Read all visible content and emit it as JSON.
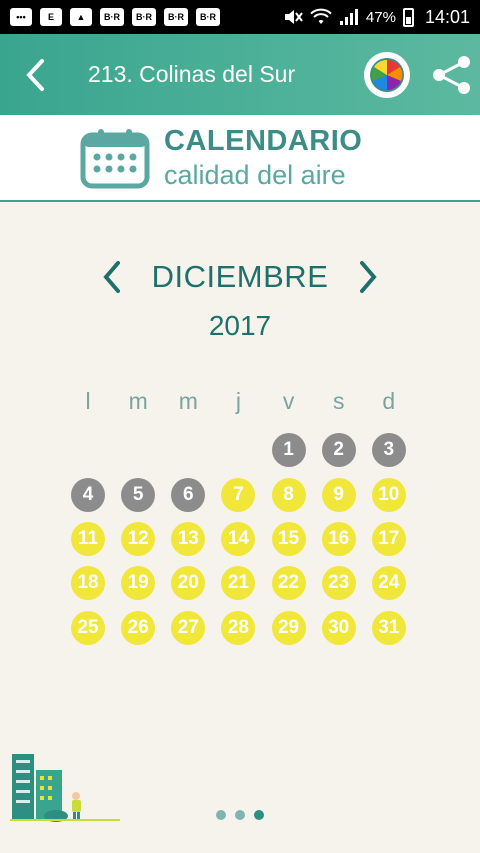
{
  "status_bar": {
    "battery": "47%",
    "time": "14:01",
    "icons": [
      "messenger-icon",
      "app-e-icon",
      "gallery-icon",
      "br-icon",
      "br-icon",
      "br-icon",
      "br-icon"
    ],
    "br_label": "B·R"
  },
  "app_bar": {
    "title": "213. Colinas del Sur",
    "background": "#3aa58f"
  },
  "header": {
    "title": "CALENDARIO",
    "subtitle": "calidad del aire"
  },
  "calendar": {
    "month": "DICIEMBRE",
    "year": "2017",
    "weekdays": [
      "l",
      "m",
      "m",
      "j",
      "v",
      "s",
      "d"
    ],
    "days": [
      {
        "n": "",
        "q": "empty"
      },
      {
        "n": "",
        "q": "empty"
      },
      {
        "n": "",
        "q": "empty"
      },
      {
        "n": "",
        "q": "empty"
      },
      {
        "n": "1",
        "q": "grey"
      },
      {
        "n": "2",
        "q": "grey"
      },
      {
        "n": "3",
        "q": "grey"
      },
      {
        "n": "4",
        "q": "grey"
      },
      {
        "n": "5",
        "q": "grey"
      },
      {
        "n": "6",
        "q": "grey"
      },
      {
        "n": "7",
        "q": "yellow"
      },
      {
        "n": "8",
        "q": "yellow"
      },
      {
        "n": "9",
        "q": "yellow"
      },
      {
        "n": "10",
        "q": "yellow"
      },
      {
        "n": "11",
        "q": "yellow"
      },
      {
        "n": "12",
        "q": "yellow"
      },
      {
        "n": "13",
        "q": "yellow"
      },
      {
        "n": "14",
        "q": "yellow"
      },
      {
        "n": "15",
        "q": "yellow"
      },
      {
        "n": "16",
        "q": "yellow"
      },
      {
        "n": "17",
        "q": "yellow"
      },
      {
        "n": "18",
        "q": "yellow"
      },
      {
        "n": "19",
        "q": "yellow"
      },
      {
        "n": "20",
        "q": "yellow"
      },
      {
        "n": "21",
        "q": "yellow"
      },
      {
        "n": "22",
        "q": "yellow"
      },
      {
        "n": "23",
        "q": "yellow"
      },
      {
        "n": "24",
        "q": "yellow"
      },
      {
        "n": "25",
        "q": "yellow"
      },
      {
        "n": "26",
        "q": "yellow"
      },
      {
        "n": "27",
        "q": "yellow"
      },
      {
        "n": "28",
        "q": "yellow"
      },
      {
        "n": "29",
        "q": "yellow"
      },
      {
        "n": "30",
        "q": "yellow"
      },
      {
        "n": "31",
        "q": "yellow"
      }
    ],
    "colors": {
      "grey": "#8c8c8c",
      "yellow": "#f1e63a"
    }
  },
  "pager": {
    "count": 3,
    "active": 2
  }
}
